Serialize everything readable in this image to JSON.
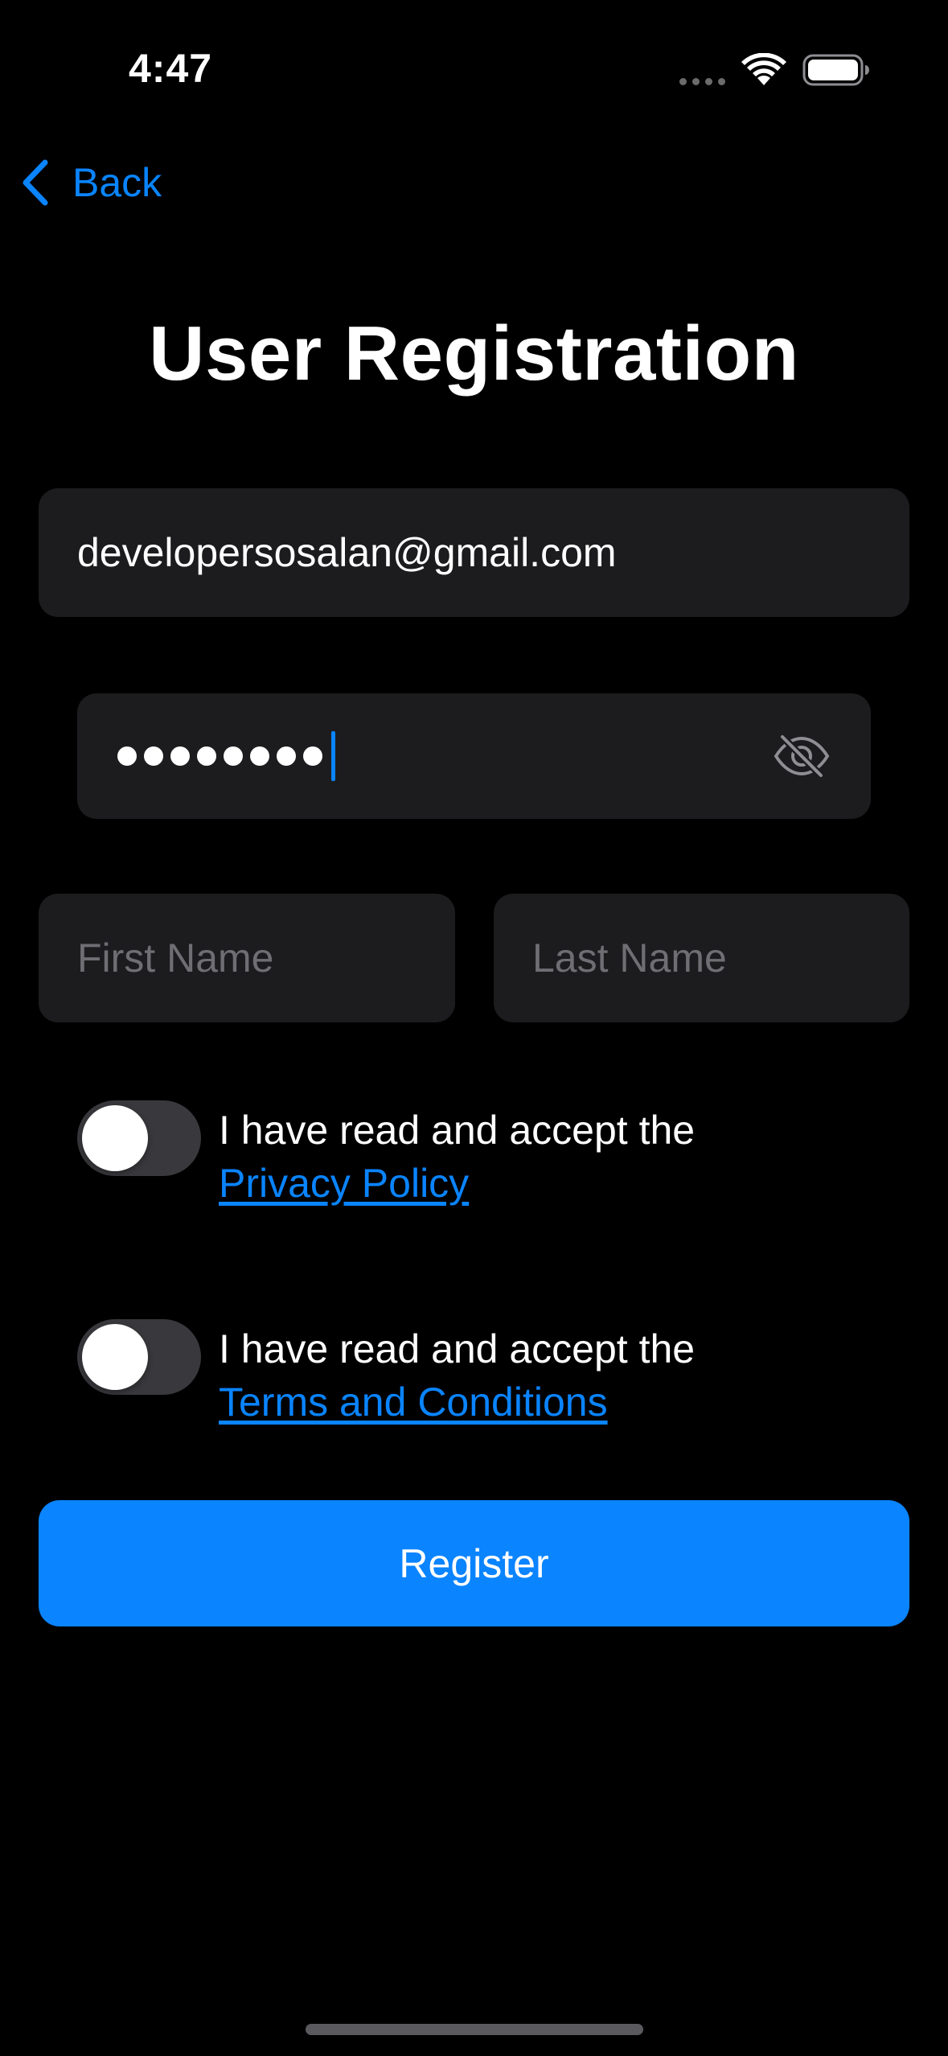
{
  "status_bar": {
    "time": "4:47"
  },
  "nav": {
    "back_label": "Back"
  },
  "title": "User Registration",
  "form": {
    "email_value": "developersosalan@gmail.com",
    "password_length": 8,
    "first_name_placeholder": "First Name",
    "last_name_placeholder": "Last Name",
    "privacy": {
      "text": "I have read and accept the",
      "link": "Privacy Policy",
      "accepted": false
    },
    "terms": {
      "text": "I have read and accept the",
      "link": "Terms and Conditions",
      "accepted": false
    },
    "register_label": "Register"
  },
  "icons": {
    "back": "chevron-left-icon",
    "wifi": "wifi-icon",
    "battery": "battery-icon",
    "password_visibility": "eye-slash-icon"
  },
  "colors": {
    "accent": "#0a84ff",
    "background": "#000000",
    "field": "#1c1c1e",
    "toggle_off": "#39393d"
  }
}
